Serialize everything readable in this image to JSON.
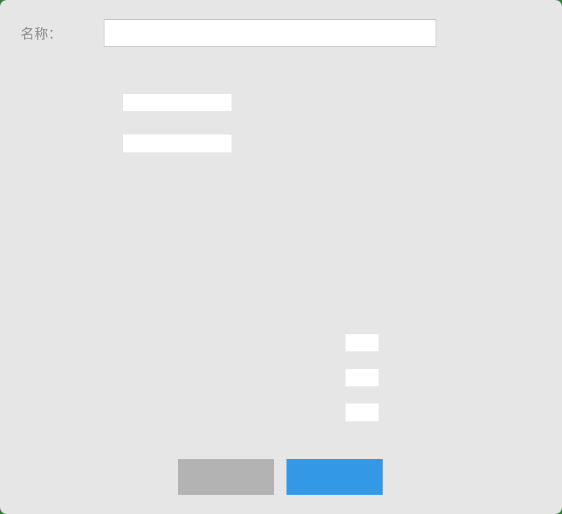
{
  "form": {
    "name_label": "名称：",
    "name_value": "",
    "fields": [
      "",
      "",
      "",
      "",
      ""
    ]
  },
  "buttons": {
    "cancel_label": "",
    "confirm_label": ""
  },
  "colors": {
    "background": "#e6e6e6",
    "field": "#ffffff",
    "cancel_button": "#b3b3b3",
    "confirm_button": "#3399e6",
    "label_text": "#8c8c8c"
  }
}
